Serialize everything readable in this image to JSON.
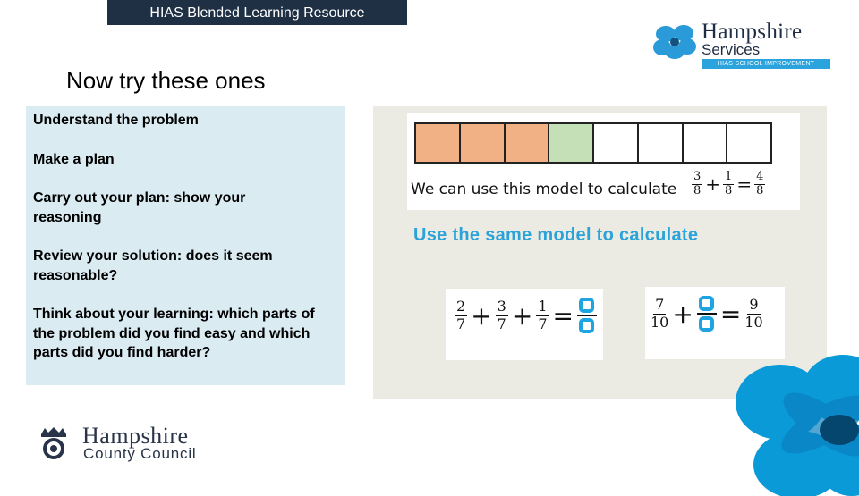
{
  "header": {
    "banner": "HIAS Blended Learning Resource"
  },
  "logos": {
    "top_right": {
      "name": "Hampshire",
      "sub": "Services",
      "tag": "HIAS SCHOOL IMPROVEMENT",
      "icon": "flower-icon"
    },
    "bottom_left": {
      "name": "Hampshire",
      "sub": "County Council",
      "icon": "crest-icon"
    }
  },
  "slide": {
    "title": "Now try these ones",
    "steps": [
      "Understand the problem",
      "Make a plan",
      "Carry out your plan: show your reasoning",
      "Review your solution: does it seem reasonable?",
      "Think about your learning: which parts of the problem did you find easy and which parts did you find harder?"
    ]
  },
  "model": {
    "total_parts": 8,
    "cells": [
      "#f2b085",
      "#f2b085",
      "#f2b085",
      "#c5dfb6",
      "#ffffff",
      "#ffffff",
      "#ffffff",
      "#ffffff"
    ],
    "caption": "We can use this model to calculate",
    "example": {
      "a": {
        "num": "3",
        "den": "8"
      },
      "op": "+",
      "b": {
        "num": "1",
        "den": "8"
      },
      "eq": "=",
      "result": {
        "num": "4",
        "den": "8"
      }
    }
  },
  "instruction": "Use the same model  to calculate",
  "problems": [
    {
      "terms": [
        {
          "num": "2",
          "den": "7"
        },
        {
          "num": "3",
          "den": "7"
        },
        {
          "num": "1",
          "den": "7"
        }
      ],
      "op": "+",
      "eq": "=",
      "answer": "blank"
    },
    {
      "first": {
        "num": "7",
        "den": "10"
      },
      "op": "+",
      "missing": "blank",
      "eq": "=",
      "result": {
        "num": "9",
        "den": "10"
      }
    }
  ],
  "colors": {
    "banner_bg": "#1f3044",
    "steps_bg": "#daebf2",
    "panel_bg": "#ecebe3",
    "accent_blue": "#2ba3d8",
    "shaded_orange": "#f2b085",
    "shaded_green": "#c5dfb6"
  }
}
